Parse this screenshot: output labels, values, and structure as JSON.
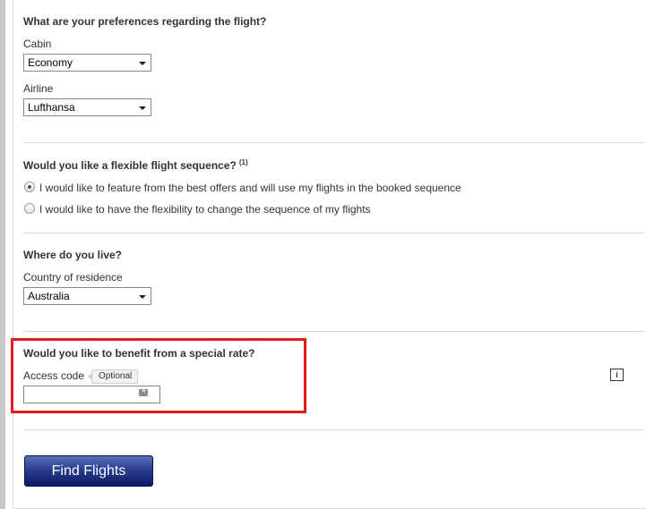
{
  "preferences": {
    "heading": "What are your preferences regarding the flight?",
    "cabin_label": "Cabin",
    "cabin_value": "Economy",
    "airline_label": "Airline",
    "airline_value": "Lufthansa"
  },
  "sequence": {
    "heading": "Would you like a flexible flight sequence?",
    "footnote": "(1)",
    "options": [
      {
        "label": "I would like to feature from the best offers and will use my flights in the booked sequence",
        "checked": true
      },
      {
        "label": "I would like to have the flexibility to change the sequence of my flights",
        "checked": false
      }
    ]
  },
  "residence": {
    "heading": "Where do you live?",
    "country_label": "Country of residence",
    "country_value": "Australia"
  },
  "special_rate": {
    "heading": "Would you like to benefit from a special rate?",
    "access_code_label": "Access code",
    "optional_tag": "Optional",
    "access_code_value": "",
    "info_icon_glyph": "i"
  },
  "actions": {
    "find_flights_label": "Find Flights"
  },
  "colors": {
    "highlight": "#e41b1b",
    "button_top": "#5a70b8",
    "button_bottom": "#0d1a66"
  },
  "icons": {
    "key": "password-key-icon",
    "info": "info-icon",
    "dropdown": "chevron-down-icon"
  }
}
